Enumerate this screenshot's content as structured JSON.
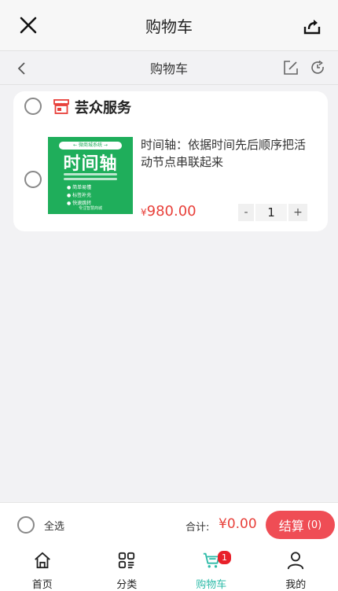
{
  "window": {
    "title": "购物车"
  },
  "header": {
    "title": "购物车"
  },
  "shop": {
    "name": "芸众服务"
  },
  "item": {
    "title": "时间轴：依据时间先后顺序把活动节点串联起来",
    "price_symbol": "¥",
    "price": "980.00",
    "quantity": "1",
    "minus_label": "-",
    "plus_label": "+",
    "thumb": {
      "badge": "← 微商城系统 →",
      "headline": "时间轴",
      "features": [
        "● 简单易懂",
        "● 标签补充",
        "● 快速跳转"
      ],
      "footer": "专注智慧商城"
    }
  },
  "checkout": {
    "select_all_label": "全选",
    "total_label": "合计:",
    "total_value": "¥0.00",
    "pay_label": "结算",
    "pay_count": "(0)"
  },
  "tabs": [
    {
      "label": "首页",
      "icon": "home-icon"
    },
    {
      "label": "分类",
      "icon": "category-icon"
    },
    {
      "label": "购物车",
      "icon": "cart-icon",
      "badge": "1"
    },
    {
      "label": "我的",
      "icon": "user-icon"
    }
  ],
  "colors": {
    "accent": "#2dbba8",
    "price": "#e8403a",
    "pay_button": "#ef4d55",
    "badge": "#e8202a"
  }
}
